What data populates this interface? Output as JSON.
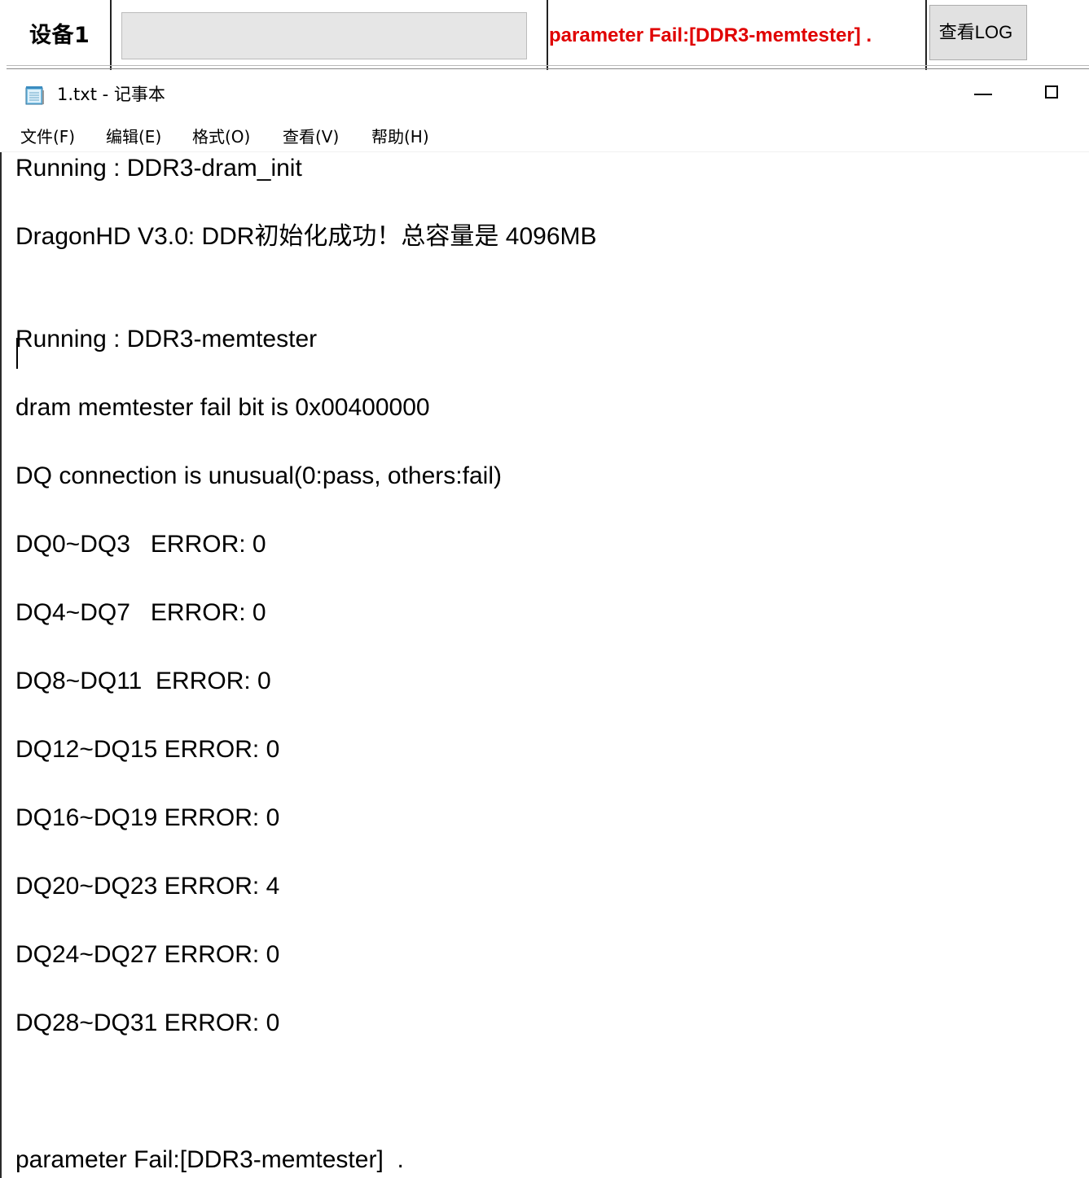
{
  "device": {
    "label": "设备1",
    "progress_fraction": 0,
    "status": "parameter Fail:[DDR3-memtester]  .",
    "log_button": "查看LOG"
  },
  "notepad": {
    "title": "1.txt - 记事本",
    "icon": "notepad-icon",
    "menu": [
      "文件(F)",
      "编辑(E)",
      "格式(O)",
      "查看(V)",
      "帮助(H)"
    ],
    "lines": [
      "Running : DDR3-dram_init",
      "DragonHD V3.0: DDR初始化成功！总容量是 4096MB",
      "Running : DDR3-memtester",
      "dram memtester fail bit is 0x00400000",
      "DQ connection is unusual(0:pass, others:fail)",
      "DQ0~DQ3   ERROR: 0",
      "DQ4~DQ7   ERROR: 0",
      "DQ8~DQ11  ERROR: 0",
      "DQ12~DQ15 ERROR: 0",
      "DQ16~DQ19 ERROR: 0",
      "DQ20~DQ23 ERROR: 4",
      "DQ24~DQ27 ERROR: 0",
      "DQ28~DQ31 ERROR: 0",
      "parameter Fail:[DDR3-memtester]  ."
    ]
  },
  "colors": {
    "status_text": "#e00000",
    "button_face": "#e1e1e1",
    "progress_track": "#e6e6e6"
  }
}
